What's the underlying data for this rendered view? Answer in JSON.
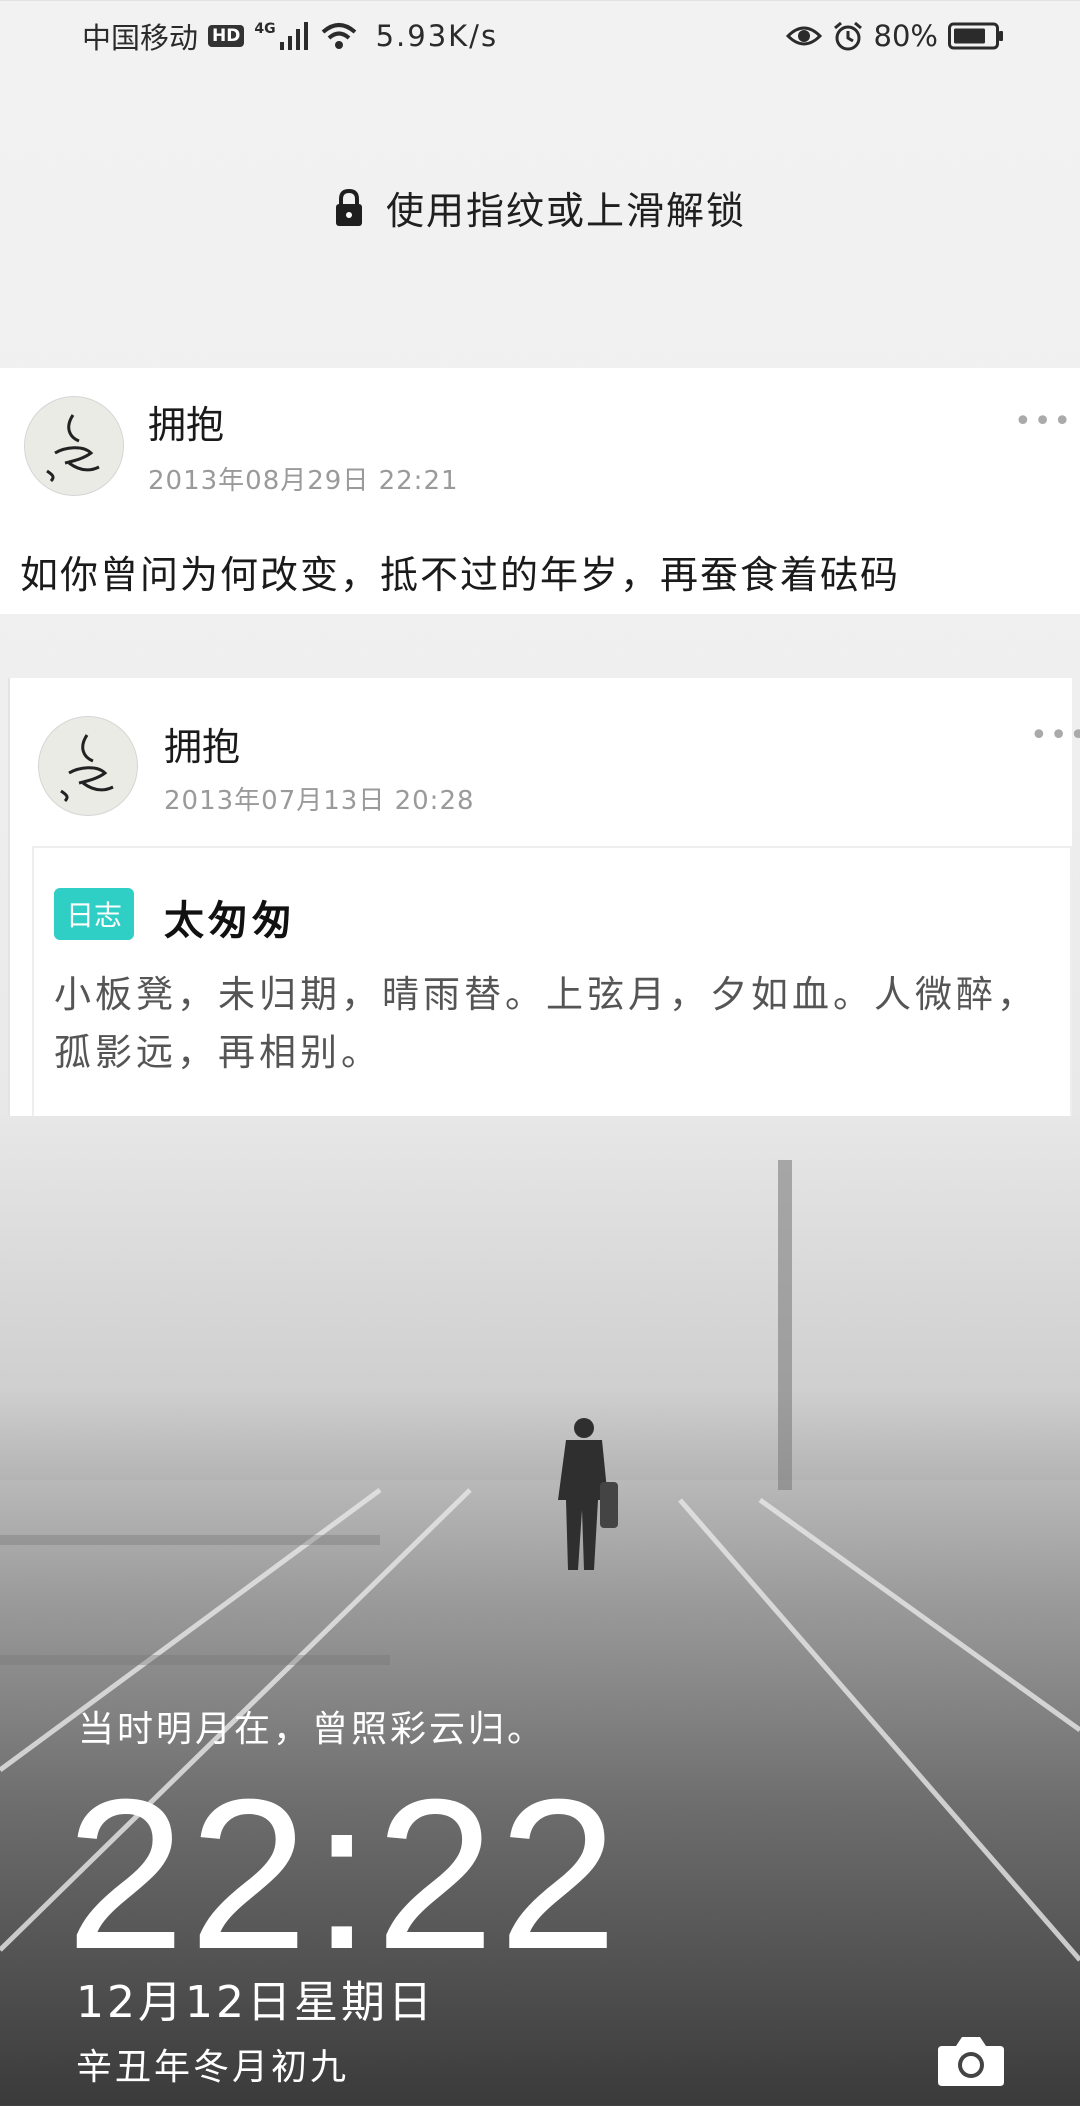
{
  "status_bar": {
    "carrier": "中国移动",
    "hd": "HD",
    "network": "4G",
    "speed": "5.93K/s",
    "battery": "80%",
    "icons": [
      "signal-icon",
      "wifi-icon",
      "eye-icon",
      "alarm-icon",
      "battery-icon"
    ]
  },
  "unlock_hint": "使用指纹或上滑解锁",
  "notifications": [
    {
      "name": "拥抱",
      "time": "2013年08月29日 22:21",
      "text": "如你曾问为何改变，抵不过的年岁，再蚕食着砝码"
    },
    {
      "name": "拥抱",
      "time": "2013年07月13日 20:28",
      "tag": "日志",
      "title": "太匆匆",
      "body": "小板凳，未归期，晴雨替。上弦月，夕如血。人微醉，孤影远，再相别。"
    }
  ],
  "lockscreen": {
    "quote": "当时明月在，曾照彩云归。",
    "time": "22:22",
    "date": "12月12日星期日",
    "lunar": "辛丑年冬月初九"
  },
  "colors": {
    "journal_tag": "#2fcfc6"
  }
}
